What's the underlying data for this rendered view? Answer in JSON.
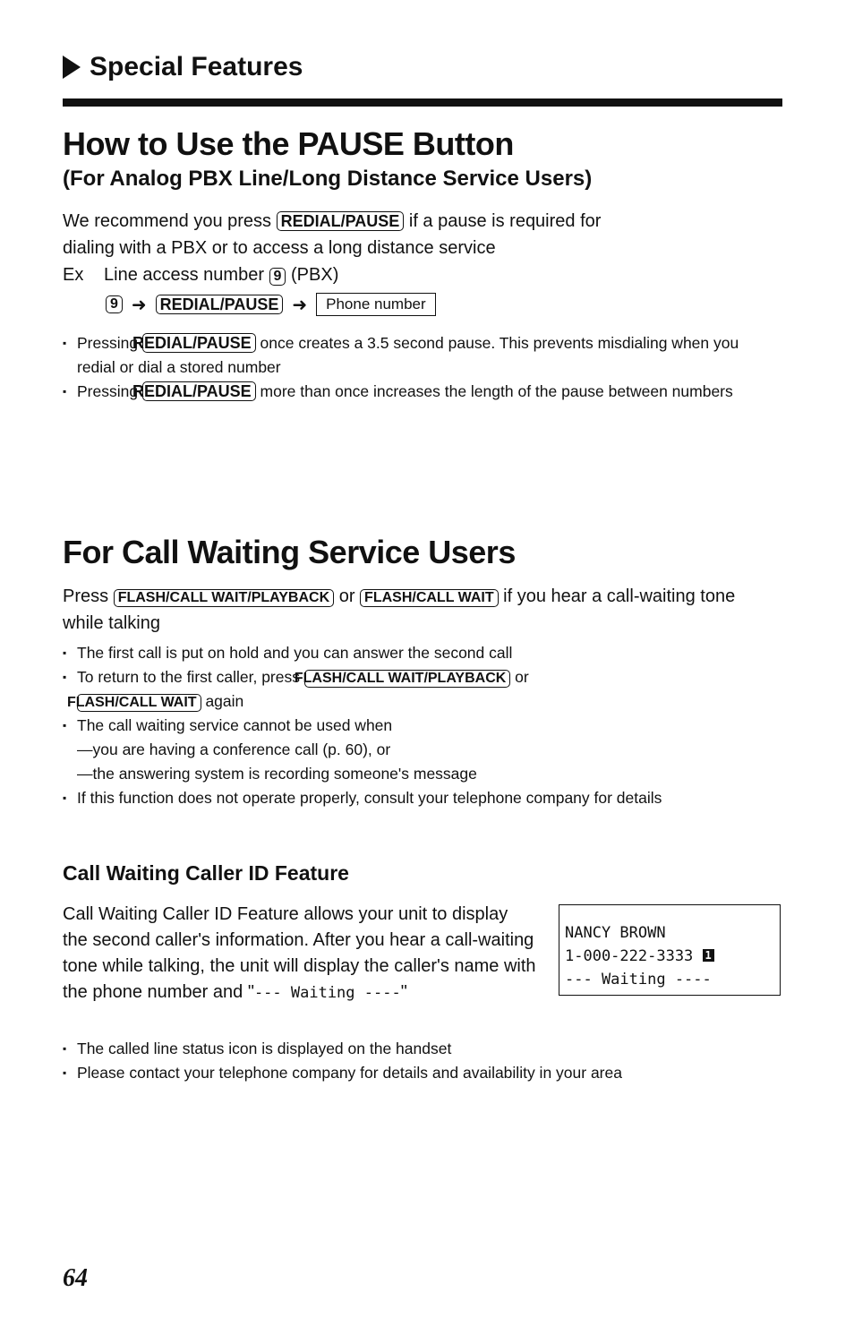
{
  "section": "Special Features",
  "pause": {
    "title": "How to Use the PAUSE Button",
    "subtitle": "(For Analog PBX Line/Long Distance Service Users)",
    "intro_a": "We recommend you press ",
    "key": "REDIAL/PAUSE",
    "intro_b": " if a pause is required for",
    "intro_c": "dialing with a PBX or to access a long distance service",
    "ex_label": "Ex",
    "ex_text": "Line access number ",
    "ex_key": "9",
    "ex_suffix": " (PBX)",
    "seq_arrow": "➜",
    "seq_box": "Phone number",
    "b1_a": "Pressing ",
    "b1_b": " once creates a 3.5 second pause. This prevents misdialing when you redial or dial a stored number",
    "b2_a": "Pressing ",
    "b2_b": " more than once increases the length of the pause between numbers"
  },
  "cw": {
    "title": "For Call Waiting Service Users",
    "p_a": "Press ",
    "key1": "FLASH/CALL WAIT/PLAYBACK",
    "p_or": " or ",
    "key2": "FLASH/CALL WAIT",
    "p_b": " if you hear a call-waiting tone while talking",
    "b1": "The first call is put on hold and you can answer the second call",
    "b2_a": "To return to the first caller, press ",
    "b2_or": " or ",
    "b2_b": " again",
    "b3": "The call waiting service cannot be used when",
    "d1": "—you are having a conference call (p. 60), or",
    "d2": "—the answering system is recording someone's message",
    "b4": "If this function does not operate properly, consult your telephone company for details"
  },
  "cwid": {
    "title": "Call Waiting Caller ID Feature",
    "para": "Call Waiting Caller ID Feature allows your unit to display the second caller's information. After you hear a call-waiting tone while talking, the unit will display the caller's name with the phone number and \"",
    "para_mono": "--- Waiting ----",
    "para_end": "\"",
    "lcd_line1": "NANCY BROWN",
    "lcd_line2": "1-000-222-3333 ",
    "lcd_icon": "1",
    "lcd_line3": "--- Waiting ----",
    "b1": "The called line status icon is displayed on the handset",
    "b2": "Please contact your telephone company for details and availability in your area"
  },
  "page_number": "64"
}
